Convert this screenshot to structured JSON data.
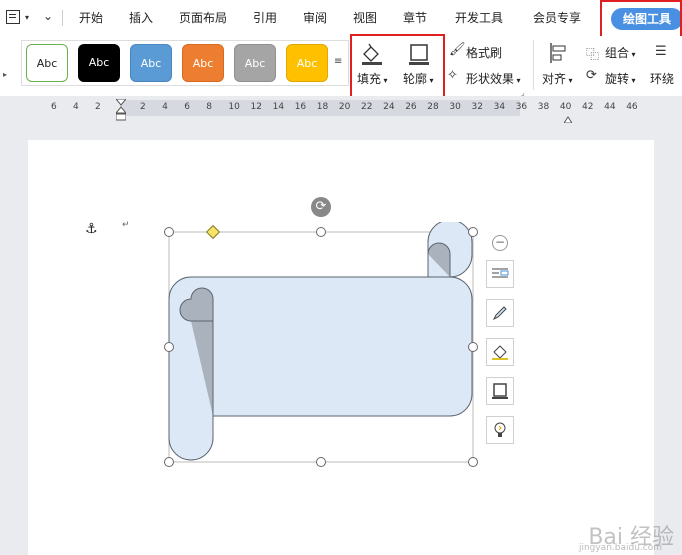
{
  "menubar": {
    "tabs": [
      "开始",
      "插入",
      "页面布局",
      "引用",
      "审阅",
      "视图",
      "章节",
      "开发工具",
      "会员专享"
    ],
    "active_tab": "绘图工具"
  },
  "ribbon": {
    "styles": [
      {
        "label": "Abc",
        "bg": "#ffffff",
        "fg": "#222222",
        "border": "#6ab04c"
      },
      {
        "label": "Abc",
        "bg": "#000000",
        "fg": "#ffffff",
        "border": "#000000"
      },
      {
        "label": "Abc",
        "bg": "#5b9bd5",
        "fg": "#ffffff",
        "border": "#4a86c0"
      },
      {
        "label": "Abc",
        "bg": "#ed7d31",
        "fg": "#ffffff",
        "border": "#d86a20"
      },
      {
        "label": "Abc",
        "bg": "#a5a5a5",
        "fg": "#ffffff",
        "border": "#909090"
      },
      {
        "label": "Abc",
        "bg": "#ffc000",
        "fg": "#ffffff",
        "border": "#e0a800"
      }
    ],
    "fill_label": "填充",
    "outline_label": "轮廓",
    "format_painter_label": "格式刷",
    "shape_effects_label": "形状效果",
    "align_label": "对齐",
    "group_label": "组合",
    "rotate_label": "旋转",
    "wrap_label": "环绕"
  },
  "ruler": {
    "numbers": [
      "6",
      "4",
      "2",
      "2",
      "4",
      "6",
      "8",
      "10",
      "12",
      "14",
      "16",
      "18",
      "20",
      "22",
      "24",
      "26",
      "28",
      "30",
      "32",
      "34",
      "36",
      "38",
      "40",
      "42",
      "44",
      "46"
    ]
  },
  "side_toolbar": {
    "buttons": [
      "layout-options-icon",
      "pen-icon",
      "fill-bucket-icon",
      "outline-icon",
      "bulb-icon"
    ]
  },
  "watermark": {
    "text": "Bai 经验",
    "sub": "jingyan.baidu.com"
  },
  "colors": {
    "accent": "#4a90e2",
    "highlight": "#e02020",
    "scroll_fill": "#dce8f5",
    "scroll_curl": "#aab3bd"
  }
}
